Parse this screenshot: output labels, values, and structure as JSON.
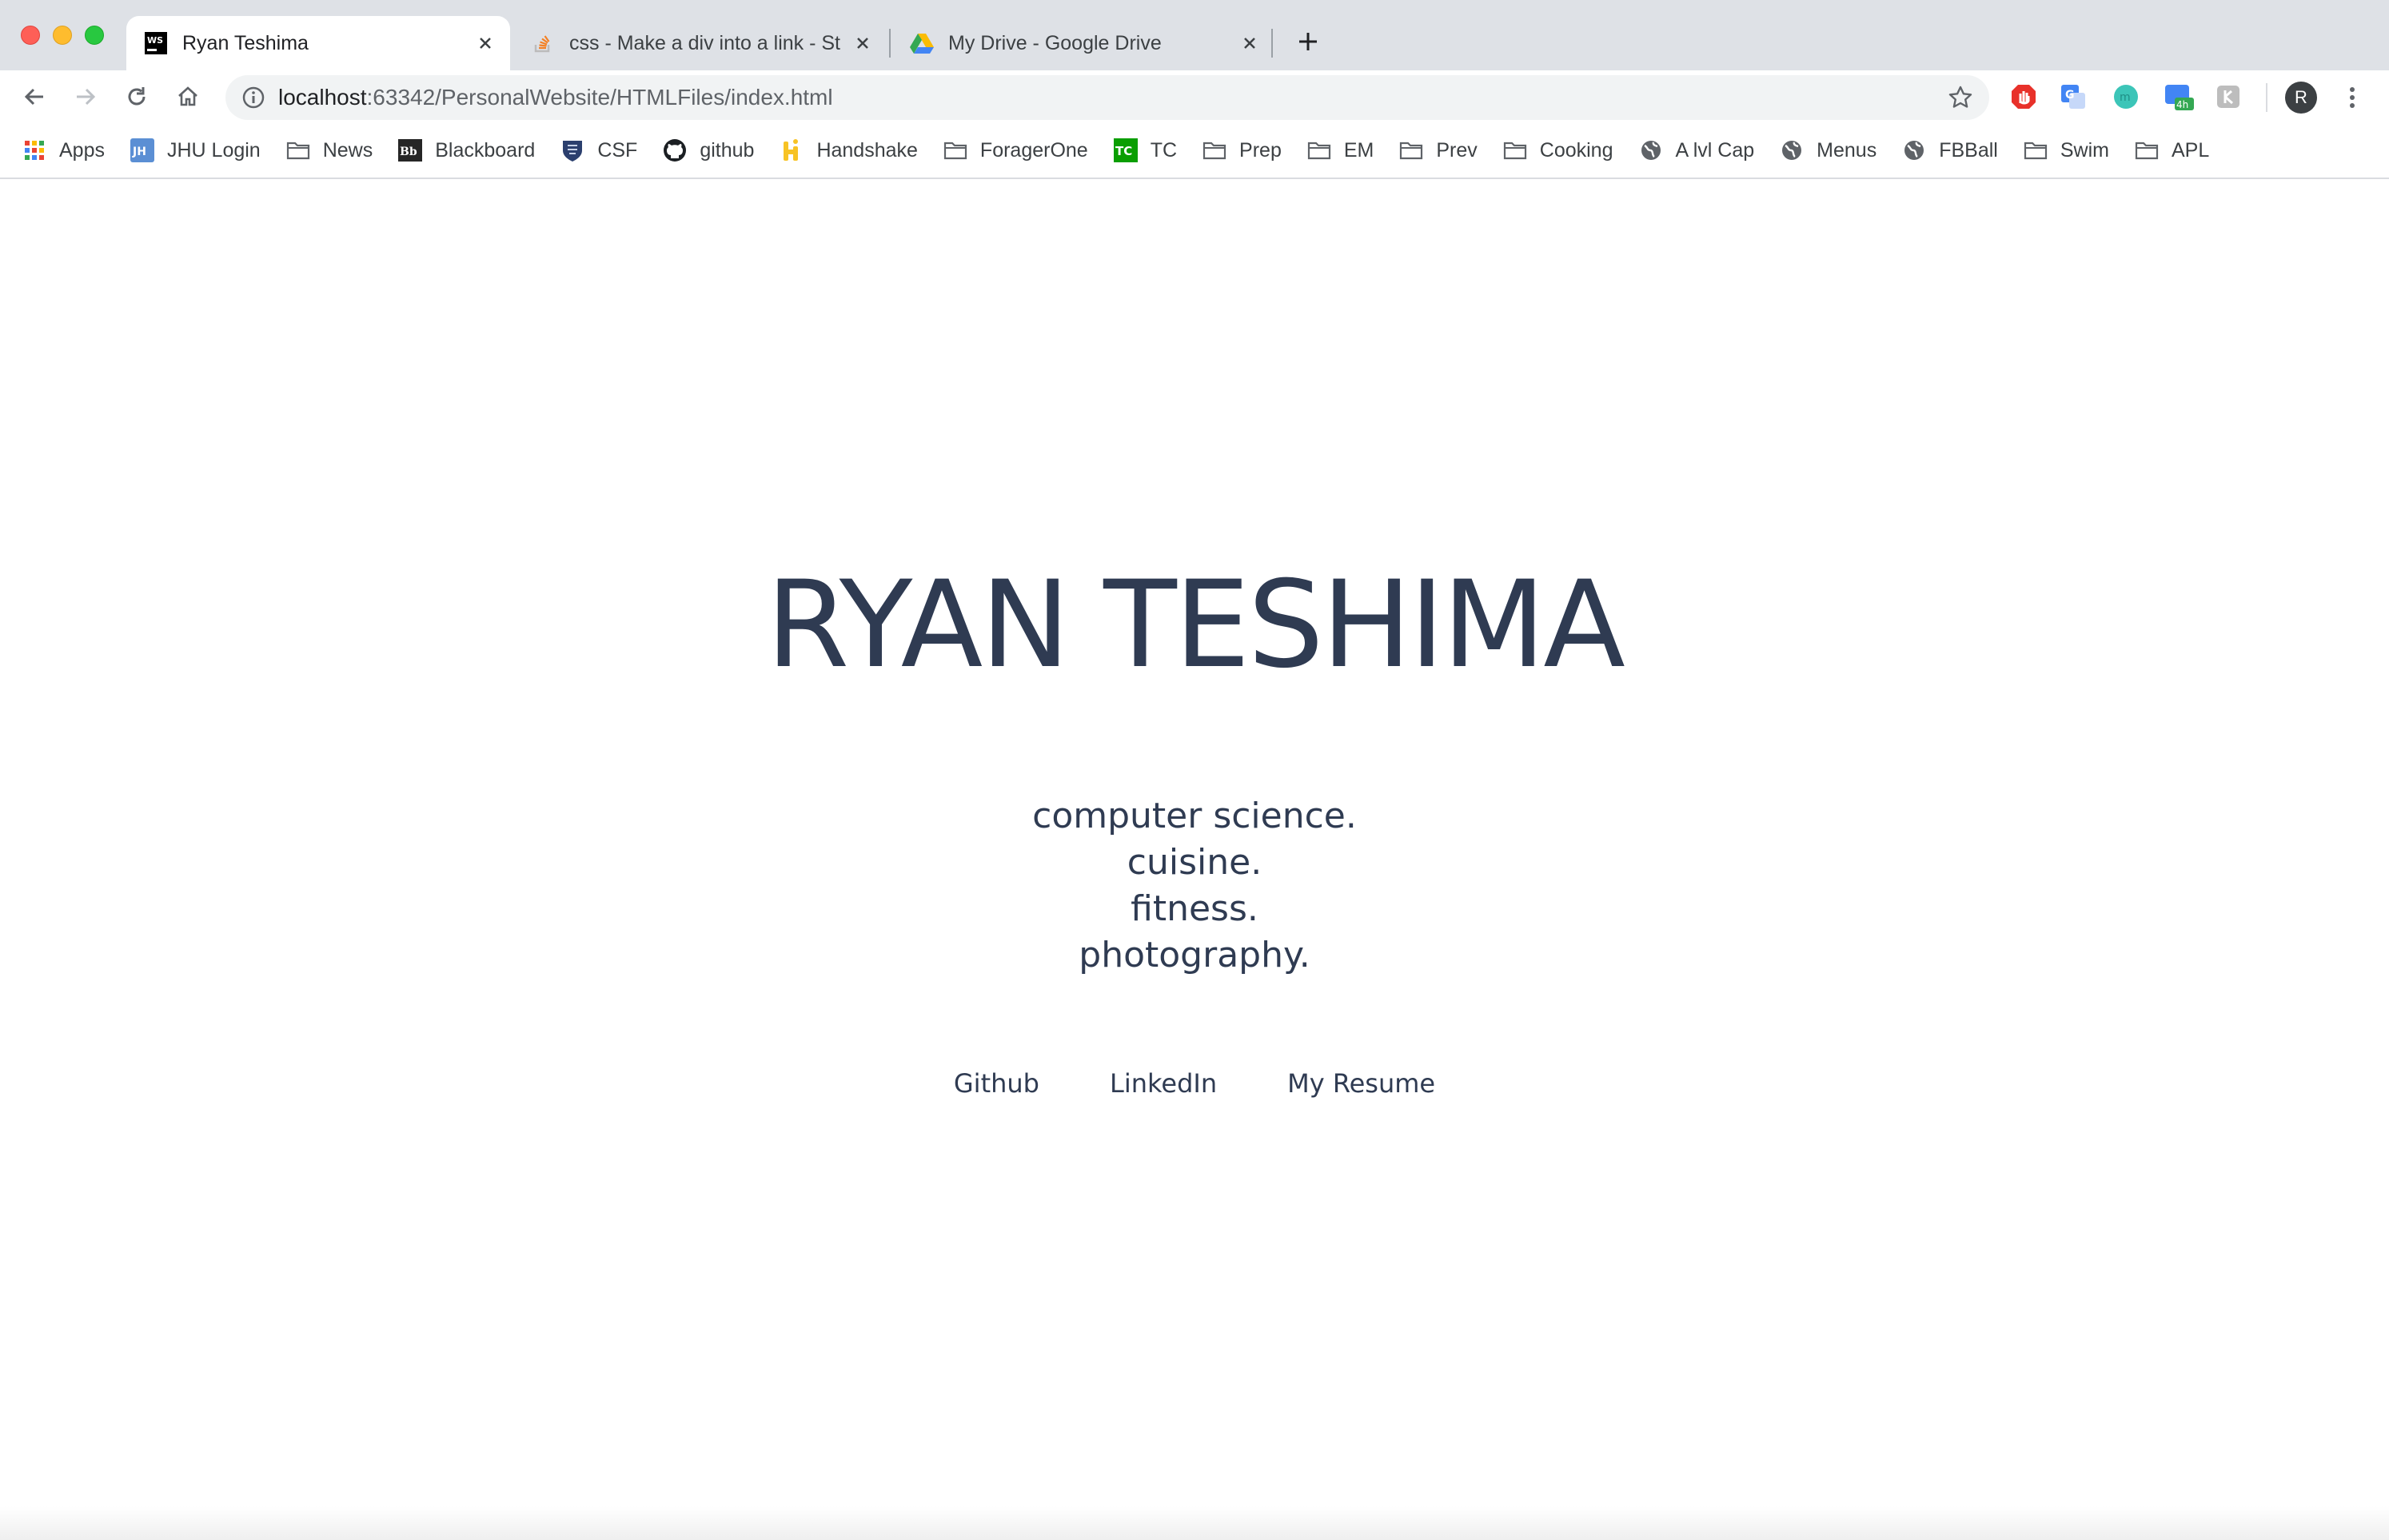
{
  "window": {
    "tabs": [
      {
        "title": "Ryan Teshima",
        "icon": "webstorm-icon",
        "active": true
      },
      {
        "title": "css - Make a div into a link - St",
        "icon": "stackoverflow-icon",
        "active": false
      },
      {
        "title": "My Drive - Google Drive",
        "icon": "google-drive-icon",
        "active": false
      }
    ]
  },
  "toolbar": {
    "url_host": "localhost",
    "url_path": ":63342/PersonalWebsite/HTMLFiles/index.html",
    "profile_initial": "R",
    "extension_badge": "4h"
  },
  "bookmarks": [
    {
      "label": "Apps",
      "icon": "apps-grid-icon"
    },
    {
      "label": "JHU Login",
      "icon": "jhu-icon"
    },
    {
      "label": "News",
      "icon": "folder-icon"
    },
    {
      "label": "Blackboard",
      "icon": "blackboard-icon"
    },
    {
      "label": "CSF",
      "icon": "shield-crest-icon"
    },
    {
      "label": "github",
      "icon": "github-icon"
    },
    {
      "label": "Handshake",
      "icon": "handshake-icon"
    },
    {
      "label": "ForagerOne",
      "icon": "folder-icon"
    },
    {
      "label": "TC",
      "icon": "techcrunch-icon"
    },
    {
      "label": "Prep",
      "icon": "folder-icon"
    },
    {
      "label": "EM",
      "icon": "folder-icon"
    },
    {
      "label": "Prev",
      "icon": "folder-icon"
    },
    {
      "label": "Cooking",
      "icon": "folder-icon"
    },
    {
      "label": "A lvl Cap",
      "icon": "globe-icon"
    },
    {
      "label": "Menus",
      "icon": "globe-icon"
    },
    {
      "label": "FBBall",
      "icon": "globe-icon"
    },
    {
      "label": "Swim",
      "icon": "folder-icon"
    },
    {
      "label": "APL",
      "icon": "folder-icon"
    }
  ],
  "page": {
    "name": "RYAN TESHIMA",
    "interests": [
      "computer science.",
      "cuisine.",
      "fitness.",
      "photography."
    ],
    "links": [
      "Github",
      "LinkedIn",
      "My Resume"
    ]
  },
  "colors": {
    "text_primary": "#2f3b52",
    "tabstrip_bg": "#dee1e6",
    "omnibox_bg": "#f1f3f4"
  }
}
